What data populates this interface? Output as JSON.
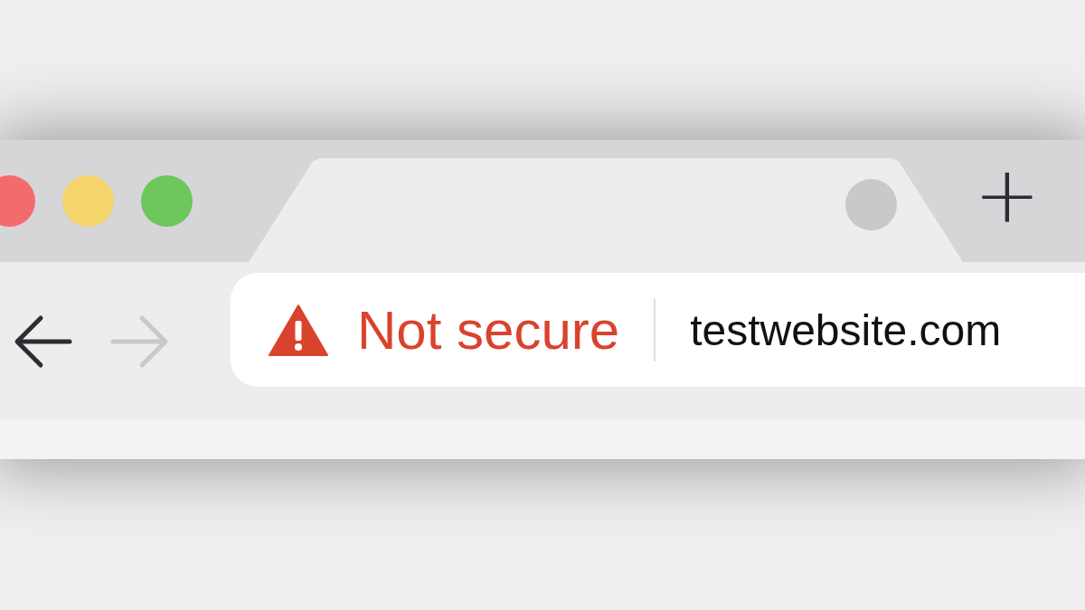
{
  "window_controls": [
    {
      "color": "#f46b6b"
    },
    {
      "color": "#f5d46b"
    },
    {
      "color": "#6cc75c"
    }
  ],
  "tab": {
    "selected": true
  },
  "new_tab_button": {
    "label": "+"
  },
  "navigation": [
    {
      "kind": "back",
      "disabled": false
    },
    {
      "kind": "forward",
      "disabled": true
    }
  ],
  "address_bar": {
    "security_label": "Not secure",
    "url": "testwebsite.com"
  }
}
